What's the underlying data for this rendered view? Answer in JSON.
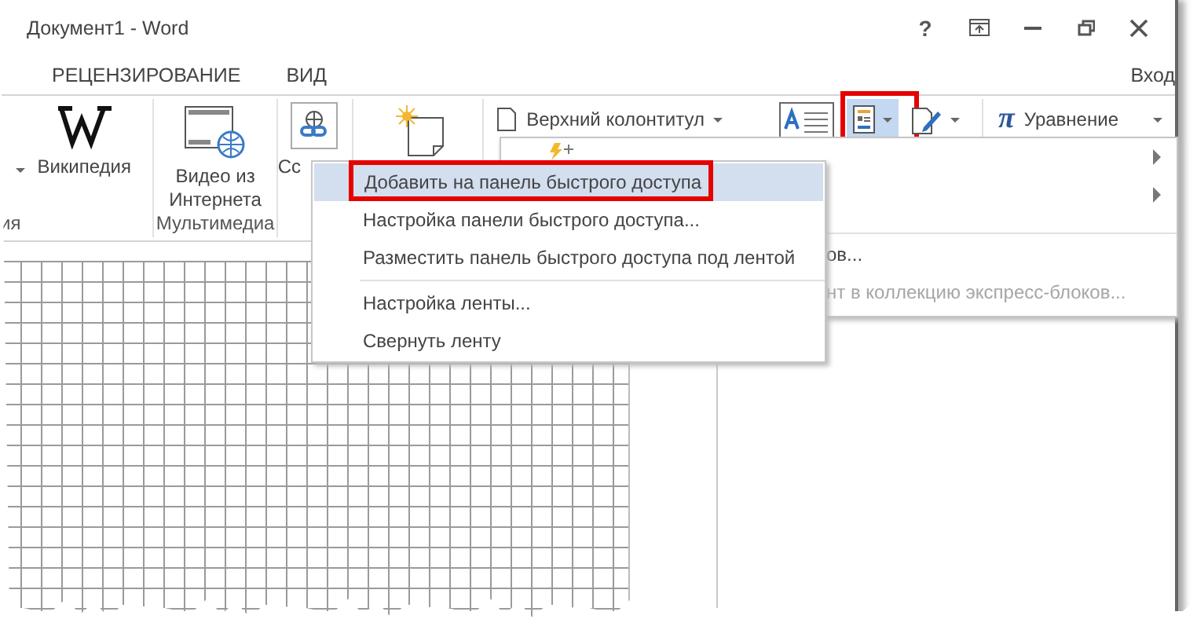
{
  "window": {
    "title": "Документ1 - Word",
    "help": "?",
    "sign_in": "Вход"
  },
  "tabs": [
    {
      "label": "РЕЦЕНЗИРОВАНИЕ",
      "selected": false
    },
    {
      "label": "ВИД",
      "selected": false
    }
  ],
  "ribbon": {
    "groups": [
      {
        "label": "ия",
        "buttons": [
          {
            "kind": "wiki",
            "label": "Википедия",
            "caret": true
          }
        ]
      },
      {
        "label": "Мультимедиа",
        "buttons": [
          {
            "kind": "video",
            "label": "Видео из Интернета"
          }
        ]
      },
      {
        "buttons": [
          {
            "kind": "link",
            "label": "Сс"
          }
        ]
      },
      {
        "buttons": [
          {
            "kind": "note"
          }
        ]
      }
    ],
    "header_footer": {
      "label": "Верхний колонтитул"
    },
    "text_tools": [
      {
        "kind": "textbox",
        "highlighted": false,
        "caret": false
      },
      {
        "kind": "quickparts",
        "highlighted": true,
        "caret": true
      },
      {
        "kind": "signature",
        "highlighted": false,
        "caret": true
      }
    ],
    "equation": {
      "symbol": "π",
      "label": "Уравнение"
    }
  },
  "gallery_menu": {
    "items": [
      {
        "kind": "autotext",
        "submenu": true
      },
      {
        "kind": "blank",
        "submenu": true
      },
      {
        "kind": "separator"
      },
      {
        "kind": "text",
        "label": "ов...",
        "disabled": false
      },
      {
        "kind": "text",
        "label": "нт в коллекцию экспресс-блоков...",
        "disabled": true
      }
    ]
  },
  "context_menu": {
    "sections": [
      [
        {
          "label": "Добавить на панель быстрого доступа",
          "selected": true,
          "highlighted": true
        },
        {
          "label": "Настройка панели быстрого доступа...",
          "selected": false,
          "highlighted": false
        },
        {
          "label": "Разместить панель быстрого доступа под лентой",
          "selected": false,
          "highlighted": false
        }
      ],
      [
        {
          "label": "Настройка ленты...",
          "selected": false,
          "highlighted": false
        },
        {
          "label": "Свернуть ленту",
          "selected": false,
          "highlighted": false
        }
      ]
    ]
  }
}
